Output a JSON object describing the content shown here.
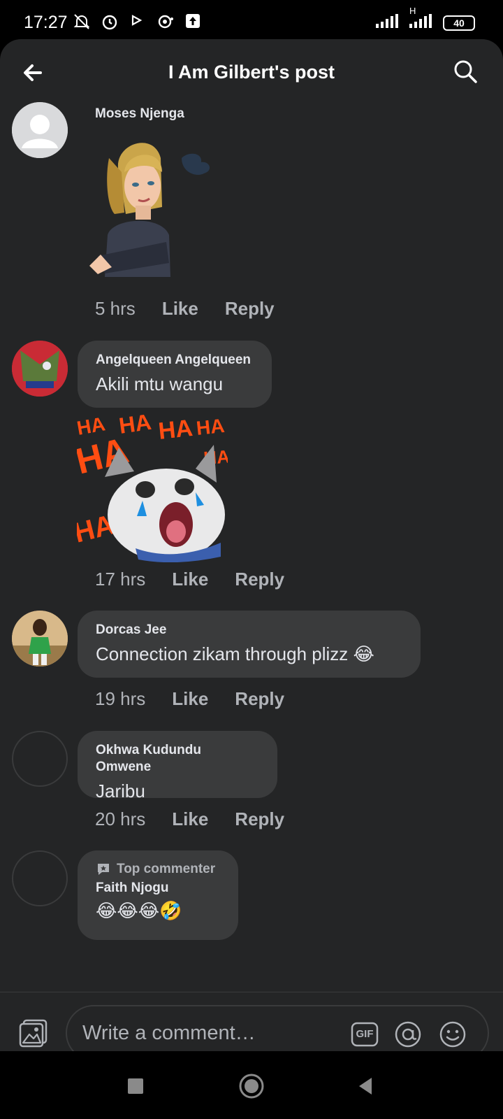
{
  "status_bar": {
    "time": "17:27",
    "battery": "40",
    "network_label": "H"
  },
  "header": {
    "title": "I Am Gilbert's post"
  },
  "comments": [
    {
      "author": "Moses Njenga",
      "text": "",
      "attachment": "sticker-woman-arms-crossed",
      "time": "5 hrs",
      "like": "Like",
      "reply": "Reply"
    },
    {
      "author": "Angelqueen Angelqueen",
      "text": "Akili mtu wangu",
      "attachment": "sticker-laughing-cat",
      "sticker_words": [
        "HA",
        "HA",
        "HA",
        "HA",
        "HA",
        "HA",
        "HA"
      ],
      "time": "17 hrs",
      "like": "Like",
      "reply": "Reply"
    },
    {
      "author": "Dorcas Jee",
      "text": "Connection zikam through plizz 😂",
      "time": "19 hrs",
      "like": "Like",
      "reply": "Reply"
    },
    {
      "author": "Okhwa Kudundu Omwene",
      "text": "Jaribu",
      "time": "20 hrs",
      "like": "Like",
      "reply": "Reply"
    },
    {
      "badge": "Top commenter",
      "author": "Faith Njogu",
      "text": "😂😂😂🤣"
    }
  ],
  "composer": {
    "placeholder": "Write a comment…",
    "gif_label": "GIF"
  },
  "colors": {
    "background": "#242526",
    "bubble": "#3a3b3c",
    "text_primary": "#e4e6eb",
    "text_secondary": "#b0b3b8"
  }
}
